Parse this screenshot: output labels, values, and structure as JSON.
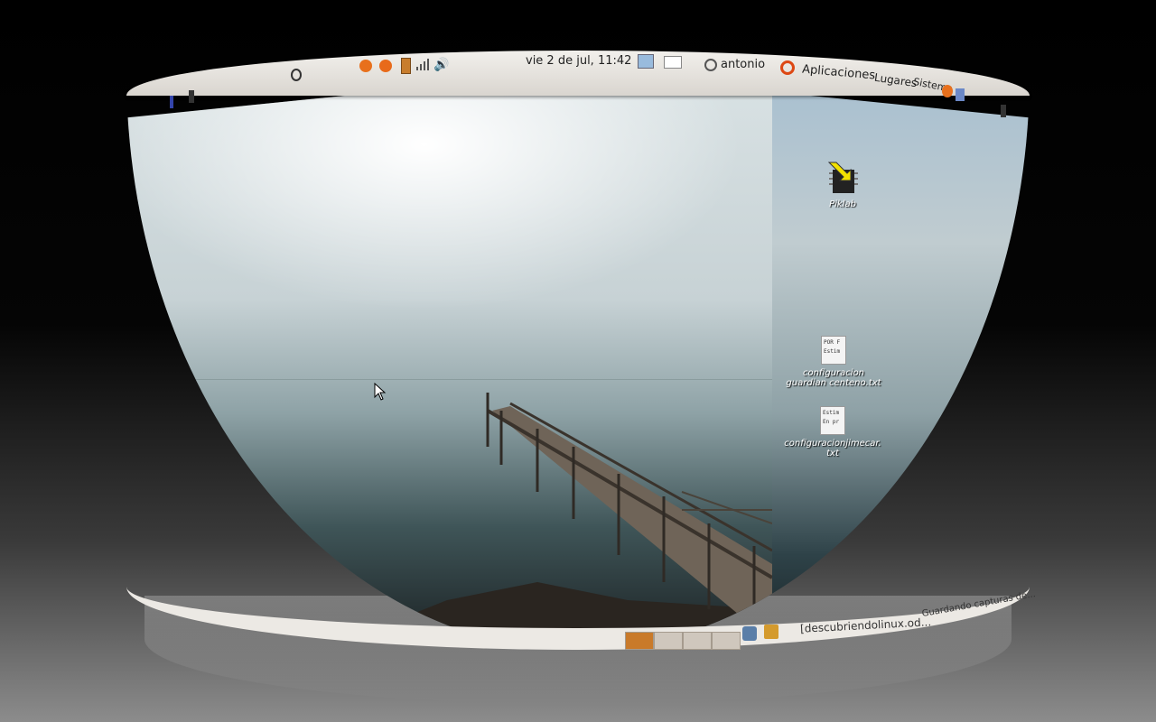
{
  "top_panel": {
    "clock": "vie  2 de jul, 11:42",
    "user": "antonio",
    "menus": [
      "Aplicaciones",
      "Lugares",
      "Sistema"
    ]
  },
  "desktop_icons": [
    {
      "label": "Piklab",
      "icon": "chip-icon"
    },
    {
      "label": "configuracion guardian centeno.txt",
      "icon": "text-file-icon",
      "preview": [
        "POR F",
        "Estim"
      ]
    },
    {
      "label": "configuracionjimecar. txt",
      "icon": "text-file-icon",
      "preview": [
        "Estim",
        "En pr"
      ]
    }
  ],
  "bottom_panel": {
    "workspaces": 4,
    "active_workspace": 1,
    "task_items": [
      "[descubriendolinux.od...",
      "Guardando capturas de..."
    ]
  },
  "colors": {
    "panel": "#ece9e4",
    "workspace_active": "#c97a2a",
    "ubuntu_orange": "#dd4814"
  }
}
